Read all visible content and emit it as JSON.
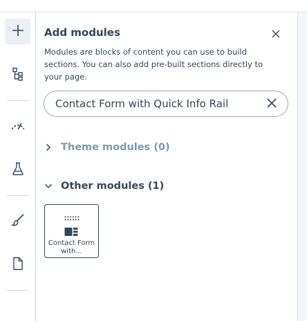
{
  "panel": {
    "title": "Add modules",
    "description": "Modules are blocks of content you can use to build sections. You can also add pre-built sections directly to your page."
  },
  "search": {
    "value": "Contact Form with Quick Info Rail",
    "placeholder": ""
  },
  "sections": [
    {
      "label": "Theme modules (0)",
      "expanded": false
    },
    {
      "label": "Other modules (1)",
      "expanded": true
    }
  ],
  "modules": [
    {
      "label": "Contact Form with...",
      "icon": "form-layout-icon"
    }
  ],
  "rail": {
    "items": [
      {
        "icon": "plus-icon",
        "active": true
      },
      {
        "icon": "structure-tree-icon"
      },
      {
        "icon": "performance-gauge-icon"
      },
      {
        "icon": "test-flask-icon"
      },
      {
        "icon": "paintbrush-icon"
      },
      {
        "icon": "page-icon"
      }
    ]
  },
  "colors": {
    "text": "#33475b",
    "muted": "#7c98b6",
    "border": "#cbd6e2",
    "active_bg": "#eaf0f6"
  }
}
